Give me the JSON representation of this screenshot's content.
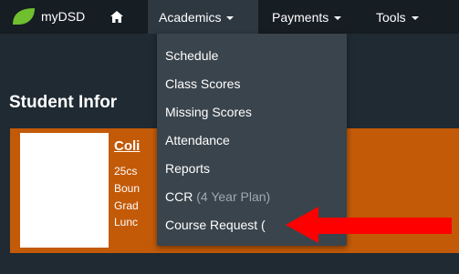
{
  "navbar": {
    "brand_text": "myDSD",
    "items": [
      {
        "label": "Academics"
      },
      {
        "label": "Payments"
      },
      {
        "label": "Tools"
      }
    ]
  },
  "page": {
    "section_title": "Student Infor"
  },
  "student": {
    "name": "Coli",
    "lines": [
      "25cs",
      "Boun",
      "Grad",
      "Lunc"
    ]
  },
  "dropdown": {
    "items": [
      {
        "label": "Schedule"
      },
      {
        "label": "Class Scores"
      },
      {
        "label": "Missing Scores"
      },
      {
        "label": "Attendance"
      },
      {
        "label": "Reports"
      },
      {
        "label": "CCR",
        "sub": " (4 Year Plan)"
      },
      {
        "label": "Course Request (",
        "sub": ""
      }
    ]
  },
  "colors": {
    "navbar": "#161d23",
    "page_bg": "#1f2a33",
    "dropdown_bg": "#3a444c",
    "card": "#c35a08",
    "logo_green": "#6fbf2f",
    "arrow": "#ff0000"
  }
}
